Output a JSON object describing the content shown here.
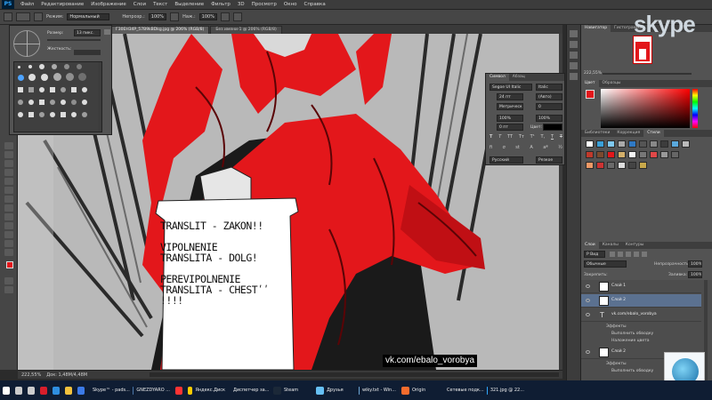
{
  "app": {
    "logo": "PS"
  },
  "menu": [
    "Файл",
    "Редактирование",
    "Изображение",
    "Слои",
    "Текст",
    "Выделение",
    "Фильтр",
    "3D",
    "Просмотр",
    "Окно",
    "Справка"
  ],
  "options": {
    "mode_label": "Режим:",
    "mode_value": "Нормальный",
    "opacity_label": "Непрозр.:",
    "opacity_value": "100%",
    "flow_label": "Наж.:",
    "flow_value": "100%"
  },
  "brush_panel": {
    "size_label": "Размер:",
    "size_value": "13 пикс.",
    "hardness_label": "Жесткость:"
  },
  "doc_tabs": [
    {
      "label": "Г30EH34P_57B9kBDkg.jpg @ 206% (RGB/8)"
    },
    {
      "label": "Без имени-1 @ 206% (RGB/8)"
    }
  ],
  "canvas": {
    "paper_lines": [
      "TRANSLIT - ZAKON!!",
      "",
      "VIPOLNENIE",
      "TRANSLITA - DOLG!",
      "",
      "PEREVIPOLNENIE",
      "TRANSLITA - CHESTʹʹ",
      "!!!!"
    ],
    "watermark": "vk.com/ebalo_vorobya"
  },
  "status": {
    "zoom": "222,55%",
    "doc": "Док: 1,48М/4,48М"
  },
  "character_panel": {
    "tab1": "Символ",
    "tab2": "Абзац",
    "font": "Segoe UI Italic",
    "style": "Italic",
    "size": "24 пт",
    "leading": "(Авто)",
    "kerning": "Метрически",
    "tracking": "0",
    "vscale": "100%",
    "hscale": "100%",
    "baseline": "0 пт",
    "color_label": "Цвет:",
    "language": "Русский",
    "aa": "Резкое",
    "style_buttons": [
      "T",
      "T",
      "TT",
      "Tт",
      "T¹",
      "T,",
      "T",
      "T"
    ]
  },
  "navigator": {
    "tab1": "Навигатор",
    "tab2": "Гистограмма",
    "zoom": "222,55%"
  },
  "color_panel": {
    "tab1": "Цвет",
    "tab2": "Образцы"
  },
  "adjustments": {
    "tab1": "Библиотеки",
    "tab2": "Коррекция",
    "tab3": "Стили"
  },
  "layers_panel": {
    "tabs": [
      "Слои",
      "Каналы",
      "Контуры"
    ],
    "kind": "Р Вид",
    "blend": "Обычные",
    "opacity_label": "Непрозрачность:",
    "opacity": "100%",
    "lock_label": "Закрепить:",
    "fill_label": "Заливка:",
    "fill": "100%",
    "layers": [
      {
        "name": "Слой 1",
        "type": "pixel"
      },
      {
        "name": "Слой 2",
        "type": "pixel"
      },
      {
        "name": "vk.com/ebalo_vorobya",
        "type": "text"
      },
      {
        "name": "Эффекты",
        "type": "effect"
      },
      {
        "name": "Выполнить обводку",
        "type": "effect"
      },
      {
        "name": "Наложение цвета",
        "type": "effect"
      },
      {
        "name": "Слой 2",
        "type": "pixel"
      },
      {
        "name": "Эффекты",
        "type": "effect"
      },
      {
        "name": "Выполнить обводку",
        "type": "effect"
      }
    ]
  },
  "overlay": {
    "skype_logo": "skype"
  },
  "taskbar": [
    {
      "label": "",
      "icon": "windows-start",
      "color": "#ffffff"
    },
    {
      "label": "",
      "icon": "search",
      "color": "#cccccc"
    },
    {
      "label": "",
      "icon": "task-view",
      "color": "#cccccc"
    },
    {
      "label": "",
      "icon": "opera",
      "color": "#d71e2b"
    },
    {
      "label": "",
      "icon": "edge",
      "color": "#2f8fe0"
    },
    {
      "label": "",
      "icon": "file-explorer",
      "color": "#f3c23d"
    },
    {
      "label": "",
      "icon": "store",
      "color": "#3c7be8"
    },
    {
      "label": "Skype™ - pads...",
      "icon": "skype",
      "color": "#00aff0"
    },
    {
      "label": "GNEZDYARO ...",
      "icon": "vk",
      "color": "#4a76a8"
    },
    {
      "label": "",
      "icon": "yandex",
      "color": "#ff3333"
    },
    {
      "label": "Яндекс.Диск",
      "icon": "disk",
      "color": "#ffcc00"
    },
    {
      "label": "Диспетчер за...",
      "icon": "task-manager",
      "color": "#3fa64b"
    },
    {
      "label": "Steam",
      "icon": "steam",
      "color": "#1b2838"
    },
    {
      "label": "Друзья",
      "icon": "steam-friends",
      "color": "#66c0f4"
    },
    {
      "label": "wiky.txt - Win...",
      "icon": "notepad",
      "color": "#6ea8d8"
    },
    {
      "label": "Origin",
      "icon": "origin",
      "color": "#f56c2d"
    },
    {
      "label": "Сетевые подк...",
      "icon": "network",
      "color": "#6f7d8c"
    },
    {
      "label": "321.jpg @ 22...",
      "icon": "photoshop",
      "color": "#31a8ff"
    }
  ],
  "colors": {
    "accent_red": "#e3171b",
    "ps_blue": "#31a8ff"
  }
}
